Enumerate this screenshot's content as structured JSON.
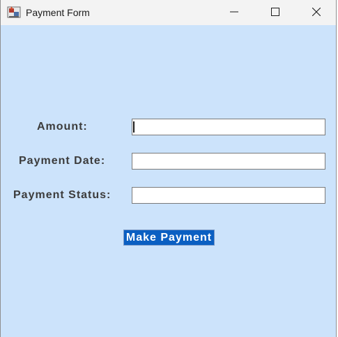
{
  "window": {
    "title": "Payment Form",
    "app_icon": "java-app-icon",
    "controls": {
      "minimize": "minimize-icon",
      "maximize": "maximize-icon",
      "close": "close-icon"
    }
  },
  "form": {
    "amount_label": "Amount:",
    "amount_value": "",
    "date_label": "Payment Date:",
    "date_value": "",
    "status_label": "Payment Status:",
    "status_value": "",
    "submit_label": "Make Payment"
  },
  "colors": {
    "background": "#cce3fb",
    "button": "#0a5fc2",
    "button_text": "#ffffff",
    "label_text": "#3c3c3c"
  }
}
